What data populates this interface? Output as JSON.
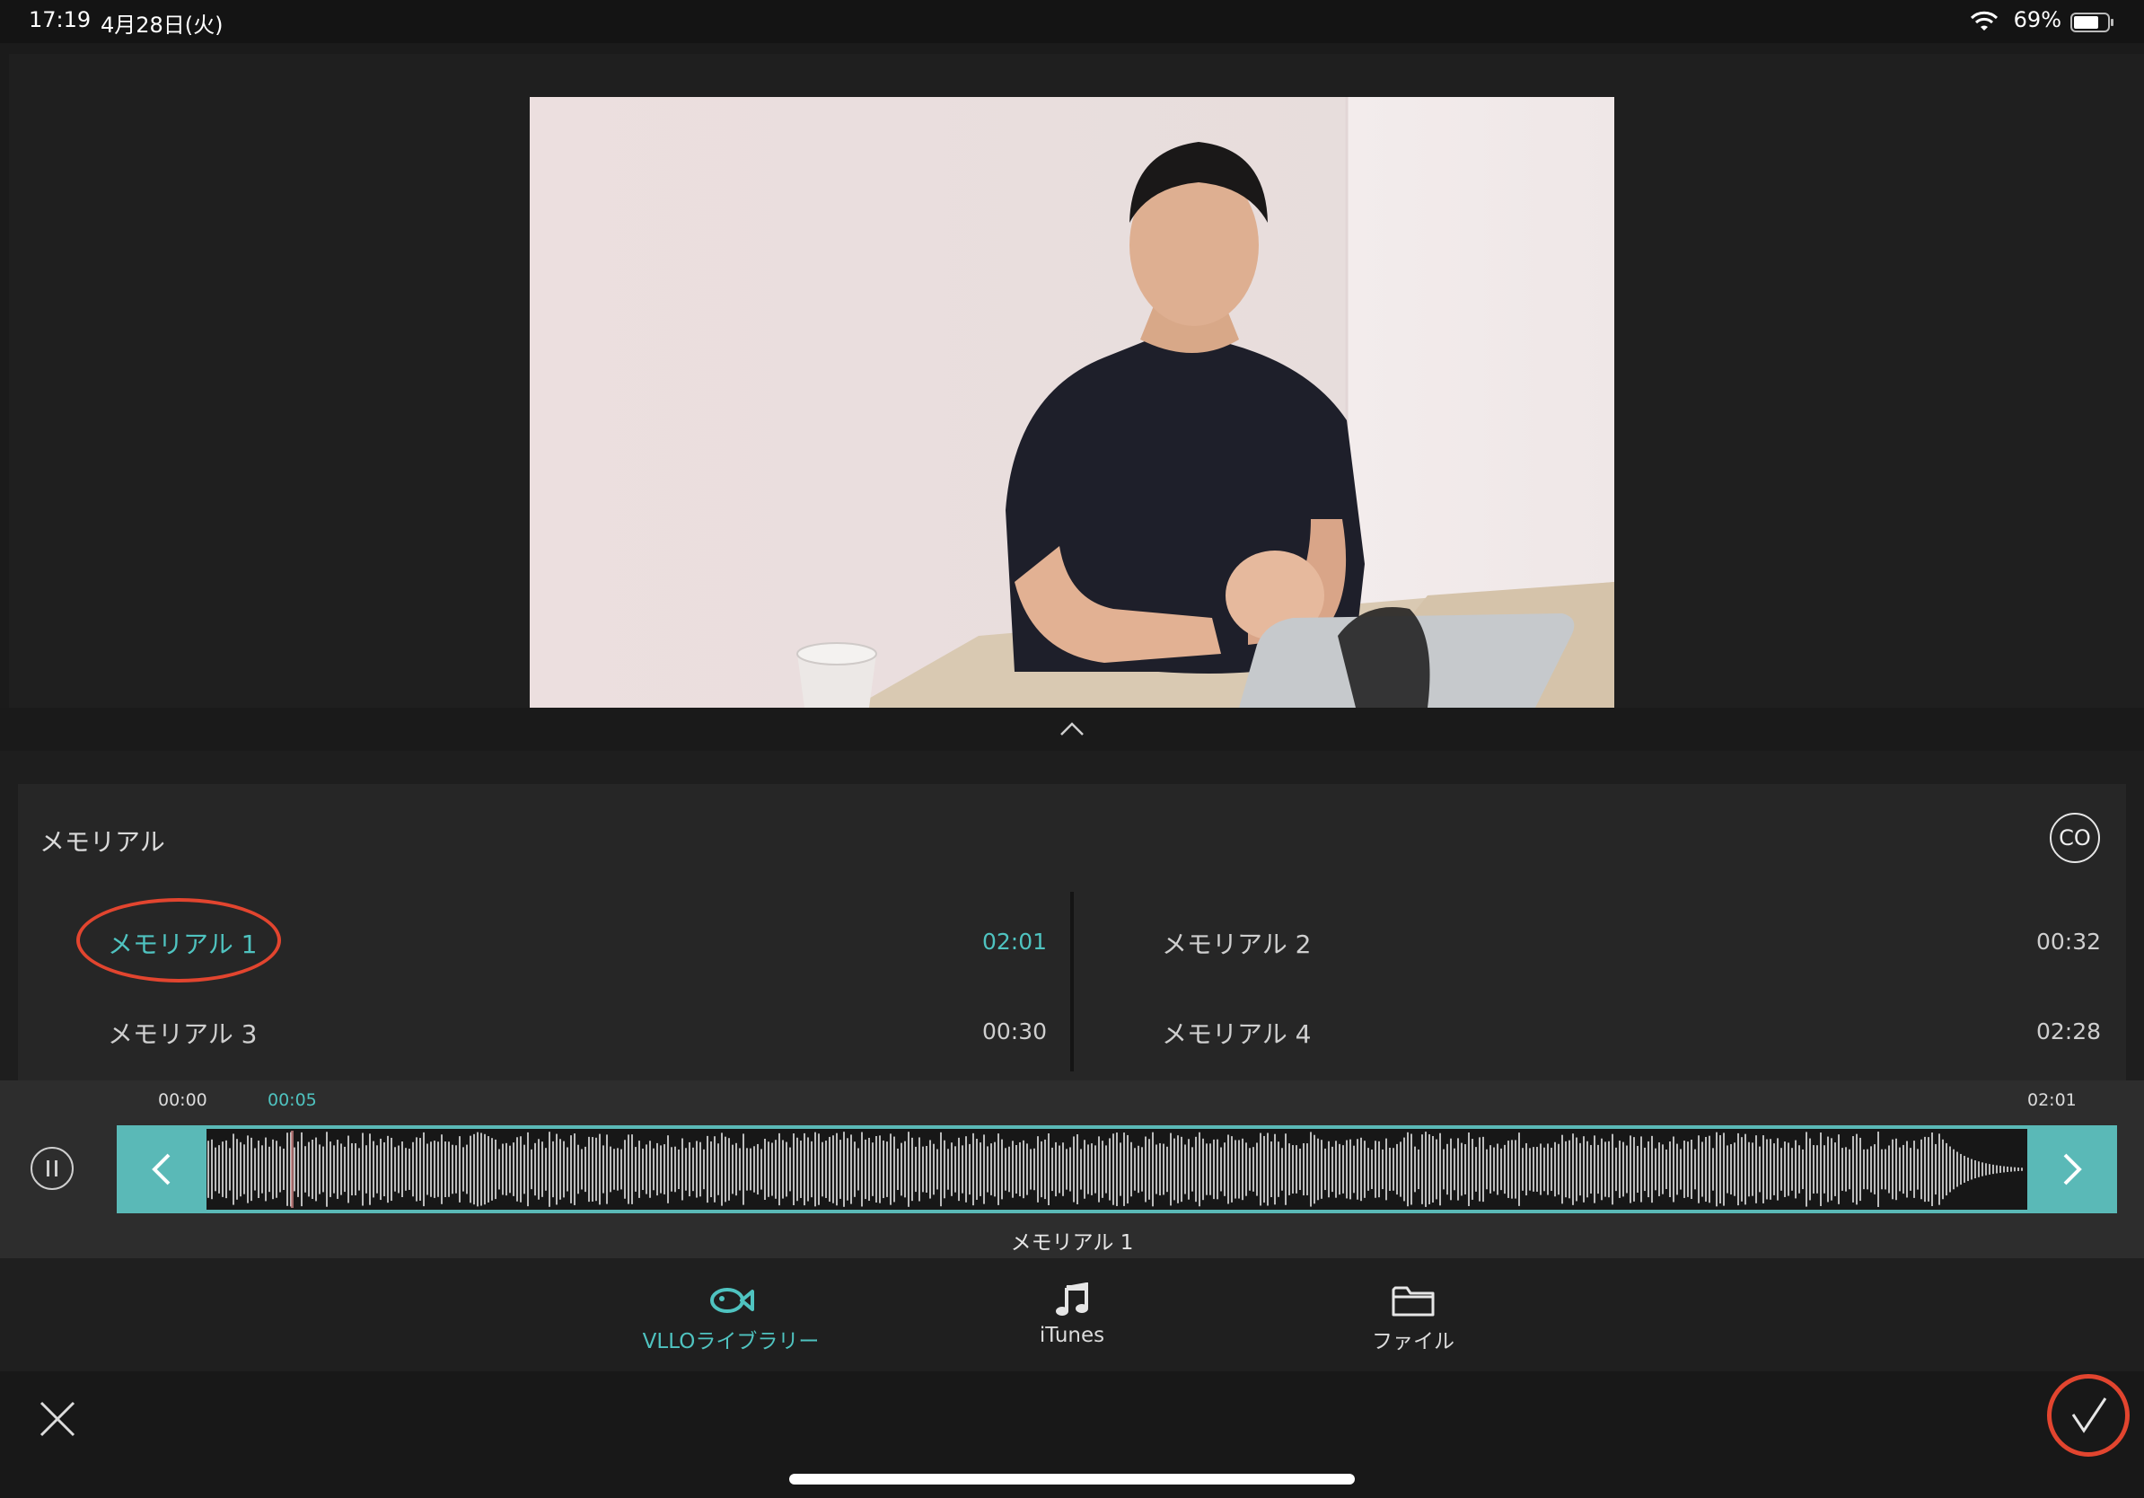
{
  "status_bar": {
    "time": "17:19",
    "date": "4月28日(火)",
    "battery": "69%"
  },
  "library": {
    "category_title": "メモリアル",
    "badge": "CO",
    "tracks": [
      {
        "name": "メモリアル 1",
        "duration": "02:01",
        "selected": true
      },
      {
        "name": "メモリアル 2",
        "duration": "00:32",
        "selected": false
      },
      {
        "name": "メモリアル 3",
        "duration": "00:30",
        "selected": false
      },
      {
        "name": "メモリアル 4",
        "duration": "02:28",
        "selected": false
      }
    ]
  },
  "player": {
    "time_start": "00:00",
    "time_current": "00:05",
    "time_end": "02:01",
    "playback_progress": 0.04,
    "waveform_caption": "メモリアル 1"
  },
  "sources": [
    {
      "label": "VLLOライブラリー",
      "icon": "fish-icon",
      "active": true
    },
    {
      "label": "iTunes",
      "icon": "music-note-icon",
      "active": false
    },
    {
      "label": "ファイル",
      "icon": "folder-icon",
      "active": false
    }
  ],
  "colors": {
    "accent": "#4fc3c0",
    "waveform_frame": "#5ab9b7",
    "annotation_circle": "#e2452f"
  }
}
